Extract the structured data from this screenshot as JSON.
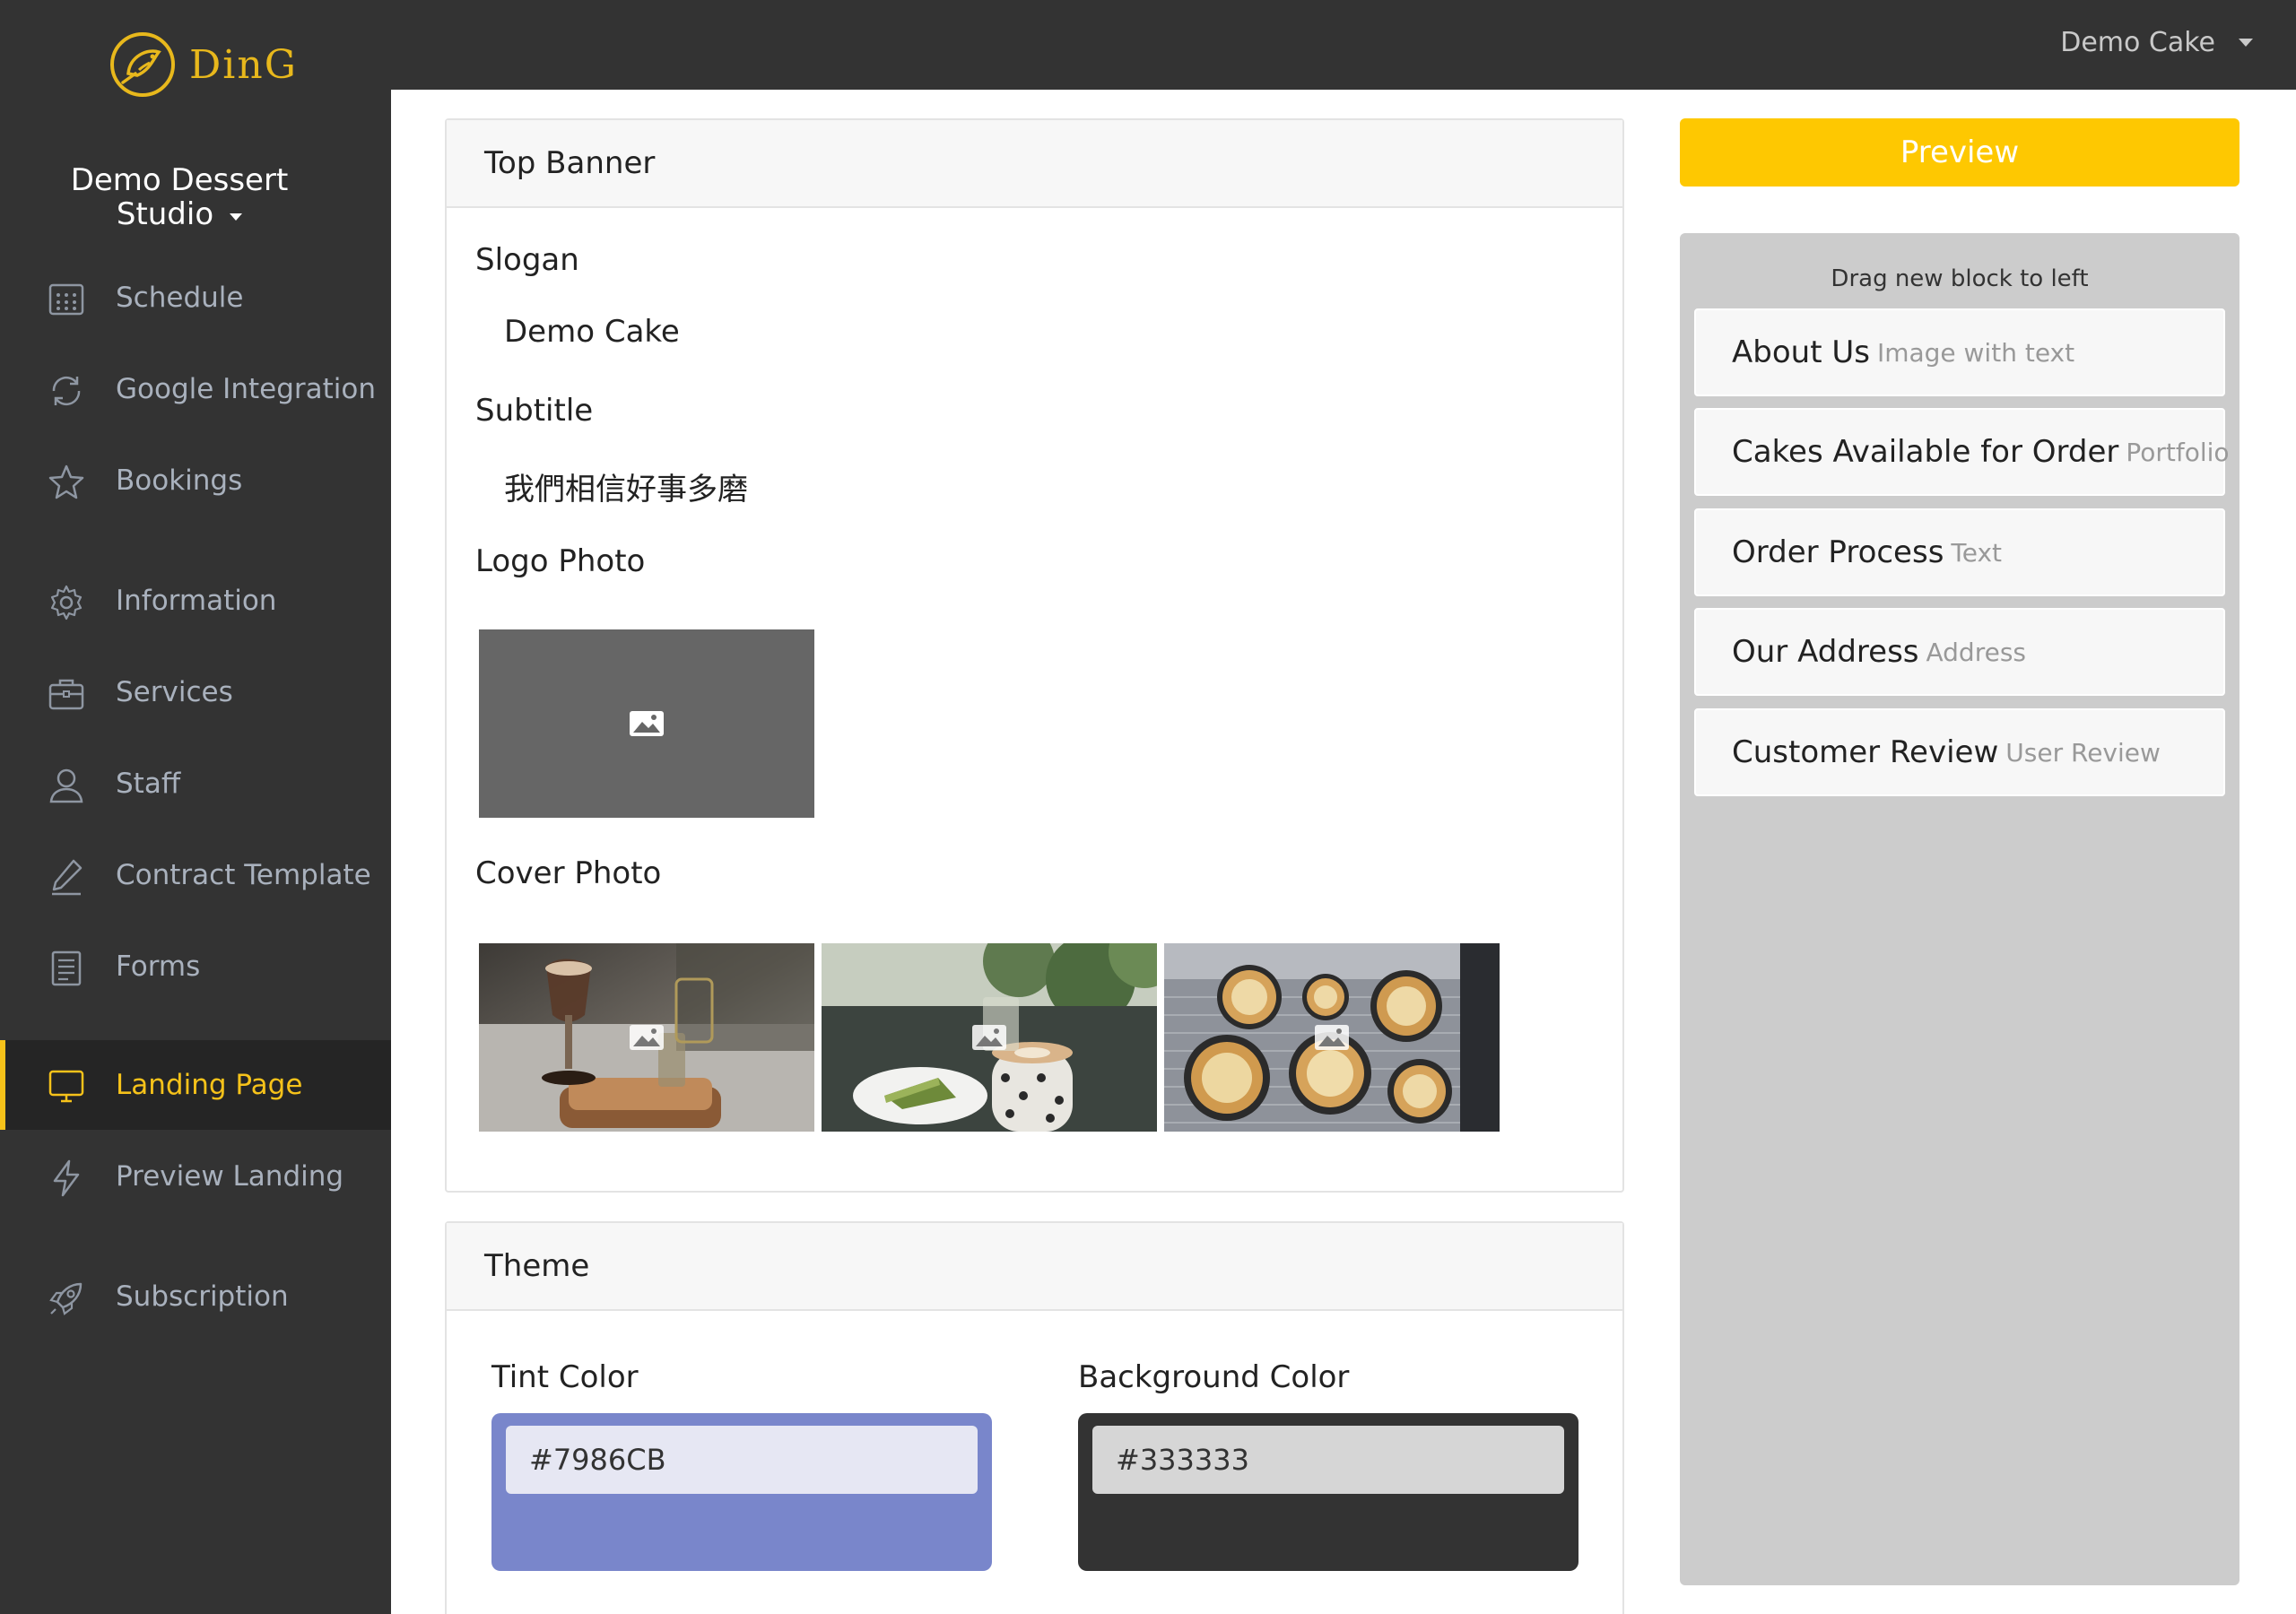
{
  "app": {
    "brand": "DinG",
    "studio_line1": "Demo Dessert",
    "studio_line2": "Studio",
    "user": "Demo Cake"
  },
  "sidebar": {
    "items": [
      {
        "label": "Schedule",
        "icon": "calendar-icon"
      },
      {
        "label": "Google Integration",
        "icon": "sync-icon"
      },
      {
        "label": "Bookings",
        "icon": "star-icon"
      },
      {
        "label": "Information",
        "icon": "gear-icon"
      },
      {
        "label": "Services",
        "icon": "briefcase-icon"
      },
      {
        "label": "Staff",
        "icon": "user-icon"
      },
      {
        "label": "Contract Template",
        "icon": "pen-icon"
      },
      {
        "label": "Forms",
        "icon": "document-icon"
      },
      {
        "label": "Landing Page",
        "icon": "monitor-icon",
        "active": true
      },
      {
        "label": "Preview Landing",
        "icon": "lightning-icon"
      },
      {
        "label": "Subscription",
        "icon": "rocket-icon"
      }
    ]
  },
  "top_banner": {
    "title": "Top Banner",
    "slogan_label": "Slogan",
    "slogan_value": "Demo Cake",
    "subtitle_label": "Subtitle",
    "subtitle_value": "我們相信好事多磨",
    "logo_label": "Logo Photo",
    "cover_label": "Cover Photo"
  },
  "theme": {
    "title": "Theme",
    "tint_label": "Tint Color",
    "tint_value": "#7986CB",
    "bg_label": "Background Color",
    "bg_value": "#333333"
  },
  "right": {
    "preview_label": "Preview",
    "hint": "Drag new block to left",
    "blocks": [
      {
        "name": "About Us",
        "type": "Image with text"
      },
      {
        "name": "Cakes Available for Order",
        "type": "Portfolio"
      },
      {
        "name": "Order Process",
        "type": "Text"
      },
      {
        "name": "Our Address",
        "type": "Address"
      },
      {
        "name": "Customer Review",
        "type": "User Review"
      }
    ]
  },
  "colors": {
    "accent": "#F6C21A",
    "sidebar_bg": "#333333",
    "preview_button": "#FEC801",
    "tint": "#7986CB",
    "background": "#333333"
  }
}
